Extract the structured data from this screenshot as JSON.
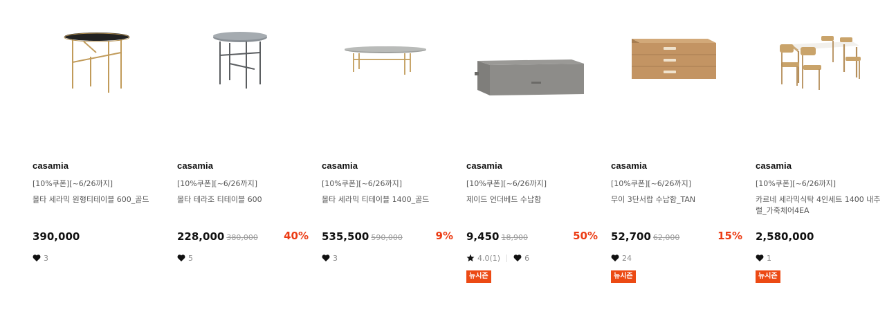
{
  "products": [
    {
      "brand": "casamia",
      "promo": "[10%쿠폰][~6/26까지]",
      "name": "몰타 세라믹 원형티테이블 600_골드",
      "price": "390,000",
      "original_price": "",
      "discount": "",
      "rating": "",
      "likes": "3",
      "badge": ""
    },
    {
      "brand": "casamia",
      "promo": "[10%쿠폰][~6/26까지]",
      "name": "몰타 테라조 티테이블 600",
      "price": "228,000",
      "original_price": "380,000",
      "discount": "40%",
      "rating": "",
      "likes": "5",
      "badge": ""
    },
    {
      "brand": "casamia",
      "promo": "[10%쿠폰][~6/26까지]",
      "name": "몰타 세라믹 티테이블 1400_골드",
      "price": "535,500",
      "original_price": "590,000",
      "discount": "9%",
      "rating": "",
      "likes": "3",
      "badge": ""
    },
    {
      "brand": "casamia",
      "promo": "[10%쿠폰][~6/26까지]",
      "name": "제이드 언더베드 수납함",
      "price": "9,450",
      "original_price": "18,900",
      "discount": "50%",
      "rating": "4.0(1)",
      "likes": "6",
      "badge": "뉴시즌"
    },
    {
      "brand": "casamia",
      "promo": "[10%쿠폰][~6/26까지]",
      "name": "무이 3단서랍 수납함_TAN",
      "price": "52,700",
      "original_price": "62,000",
      "discount": "15%",
      "rating": "",
      "likes": "24",
      "badge": "뉴시즌"
    },
    {
      "brand": "casamia",
      "promo": "[10%쿠폰][~6/26까지]",
      "name": "카르네 세라믹식탁 4인세트 1400 내추럴_가죽체어4EA",
      "price": "2,580,000",
      "original_price": "",
      "discount": "",
      "rating": "",
      "likes": "1",
      "badge": "뉴시즌"
    }
  ],
  "colors": {
    "discount": "#ec3c14",
    "badge_bg": "#ec4a14",
    "text": "#222222",
    "muted": "#8a8a8a"
  },
  "icons": {
    "like": "heart-icon",
    "rating": "star-icon"
  }
}
